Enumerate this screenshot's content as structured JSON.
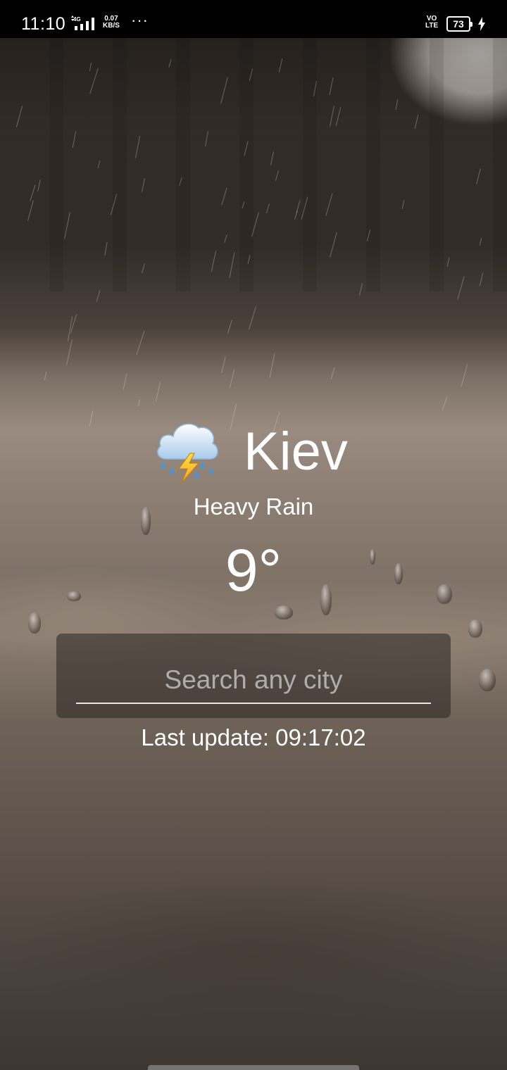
{
  "status_bar": {
    "time": "11:10",
    "network_type": "4G",
    "speed_value": "0.07",
    "speed_unit": "KB/S",
    "more": "···",
    "volte_top": "VO",
    "volte_bottom": "LTE",
    "battery": "73",
    "icons": [
      "signal-icon",
      "more-icon",
      "volte-icon",
      "battery-icon",
      "charging-icon"
    ]
  },
  "weather": {
    "icon": "thunderstorm-icon",
    "city": "Kiev",
    "condition": "Heavy Rain",
    "temperature": "9°"
  },
  "search": {
    "placeholder": "Search any city",
    "value": ""
  },
  "last_update": "Last update: 09:17:02",
  "colors": {
    "text": "#ffffff",
    "card": "#28241f",
    "underline": "#e8e8e8"
  }
}
